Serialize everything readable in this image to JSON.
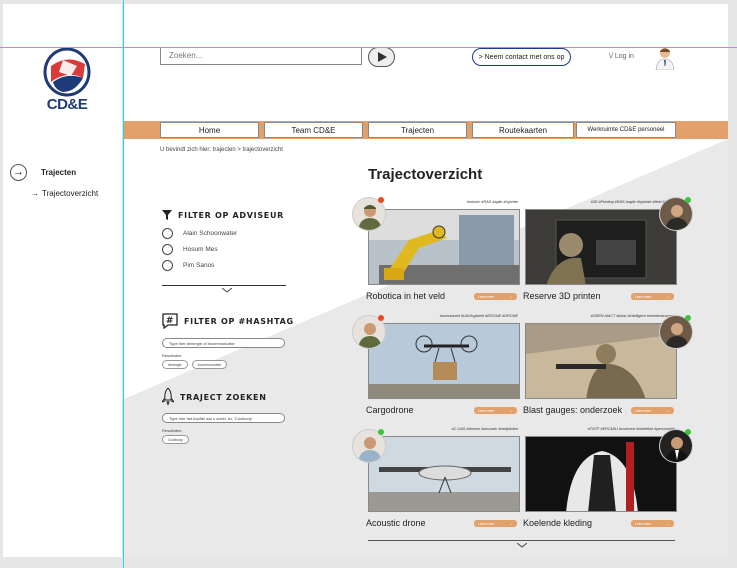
{
  "header": {
    "search_placeholder": "Zoeken...",
    "contact_label": "> Neem contact met ons op",
    "login_label": "\\/ Log in"
  },
  "logo": {
    "text": "CD&E"
  },
  "sidebar": {
    "main_item": "Trajecten",
    "sub_item": "Trajectoverzicht",
    "sub_arrow": "→",
    "main_arrow": "→"
  },
  "nav": {
    "items": [
      "Home",
      "Team CD&E",
      "Trajecten",
      "Routekaarten",
      "Werkruimte CD&E personeel"
    ]
  },
  "breadcrumb": "U bevindt zich hier: trajecten > trajectoverzicht",
  "page_title": "Trajectoverzicht",
  "filters": {
    "adviser_title": "FILTER OP ADVISEUR",
    "advisers": [
      "Alain Schoonwater",
      "Hosum Mes",
      "Pim Sanos"
    ],
    "hashtag_title": "FILTER OP #HASHTAG",
    "hashtag_placeholder": "Type hier #energie of #communicatie",
    "hashtag_results_label": "Resultaten:",
    "hashtag_results": [
      "#energie",
      "#communicatie"
    ],
    "search_title": "TRAJECT ZOEKEN",
    "search_placeholder": "Type hier het kopttel dat u zoekt. bv. 'Coolbody'",
    "search_results_label": "Resultaten:",
    "search_results": [
      "Coolbody"
    ]
  },
  "cards": [
    {
      "title": "Robotica in het veld",
      "tags": "#robotic #RAS #agile #hybride",
      "more": "Lees meer",
      "status_color": "#e84a1f"
    },
    {
      "title": "Reserve 3D printen",
      "tags": "#3D #Printing #RAS #agile #hybride #field #sparts",
      "more": "Lees meer",
      "status_color": "#3cc43c"
    },
    {
      "title": "Cargodrone",
      "tags": "#unmanned #UAVlogistiek #DRONE #DRONE",
      "more": "Lees meer",
      "status_color": "#e84a1f"
    },
    {
      "title": "Blast gauges: onderzoek",
      "tags": "#CBRN #IACT #blast #intelligent #meetinstrument",
      "more": "Lees meer",
      "status_color": "#3cc43c"
    },
    {
      "title": "Acoustic drone",
      "tags": "#C-UAS #drones #acoustic #nedpiloten",
      "more": "Lees meer",
      "status_color": "#3cc43c"
    },
    {
      "title": "Koelende kleding",
      "tags": "#TNTF #ERCMILI #coolvest #intellekte #persoonlek",
      "more": "Lees meer",
      "status_color": "#3cc43c"
    }
  ],
  "colors": {
    "accent": "#e2a06b",
    "brand_blue": "#1f3a78",
    "guide": "#27d3e6"
  }
}
